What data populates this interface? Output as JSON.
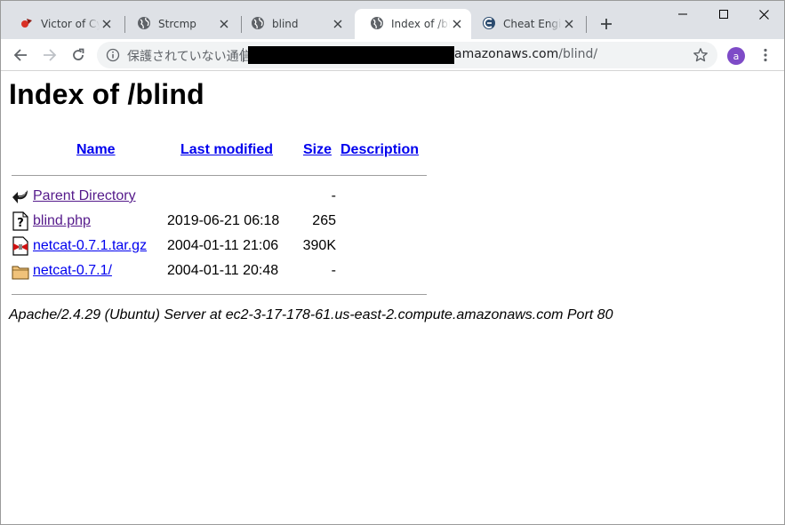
{
  "browser": {
    "tabs": [
      {
        "title": "Victor of Cyb",
        "icon": "red-media-icon",
        "active": false
      },
      {
        "title": "Strcmp",
        "icon": "globe-icon",
        "active": false
      },
      {
        "title": "blind",
        "icon": "globe-icon",
        "active": false
      },
      {
        "title": "Index of /blind",
        "icon": "globe-icon",
        "active": true
      },
      {
        "title": "Cheat Engine",
        "icon": "cheat-engine-icon",
        "active": false
      }
    ],
    "security_label": "保護されていない通信",
    "url_host": "amazonaws.com",
    "url_path": "/blind/",
    "avatar_letter": "a",
    "accent_color": "#7e4bc7"
  },
  "page": {
    "title": "Index of /blind",
    "columns": {
      "name": "Name",
      "last_modified": "Last modified",
      "size": "Size",
      "description": "Description"
    },
    "rows": [
      {
        "icon": "back-arrow-icon",
        "name": "Parent Directory",
        "modified": "",
        "size": "-",
        "visited": true
      },
      {
        "icon": "unknown-file-icon",
        "name": "blind.php",
        "modified": "2019-06-21 06:18",
        "size": "265",
        "visited": true
      },
      {
        "icon": "compressed-file-icon",
        "name": "netcat-0.7.1.tar.gz",
        "modified": "2004-01-11 21:06",
        "size": "390K",
        "visited": false
      },
      {
        "icon": "folder-icon",
        "name": "netcat-0.7.1/",
        "modified": "2004-01-11 20:48",
        "size": "-",
        "visited": false
      }
    ],
    "footer": "Apache/2.4.29 (Ubuntu) Server at ec2-3-17-178-61.us-east-2.compute.amazonaws.com Port 80"
  }
}
